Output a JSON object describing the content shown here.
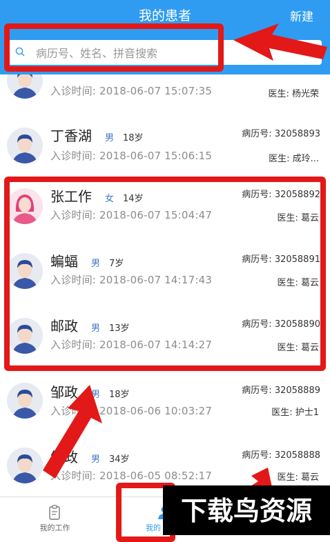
{
  "header": {
    "title": "我的患者",
    "new_label": "新建"
  },
  "search": {
    "placeholder": "病历号、姓名、拼音搜索"
  },
  "patients": [
    {
      "name": "",
      "gender": "",
      "age": "",
      "visit_label": "入诊时间:",
      "visit_time": "2018-06-07 15:07:35",
      "record_label": "",
      "record_no": "",
      "doctor_label": "医生:",
      "doctor": "杨光荣",
      "avatar": "male"
    },
    {
      "name": "丁香湖",
      "gender": "男",
      "age": "18岁",
      "visit_label": "入诊时间:",
      "visit_time": "2018-06-07 15:06:15",
      "record_label": "病历号:",
      "record_no": "32058893",
      "doctor_label": "医生:",
      "doctor": "成玲...",
      "avatar": "male"
    },
    {
      "name": "张工作",
      "gender": "女",
      "age": "14岁",
      "visit_label": "入诊时间:",
      "visit_time": "2018-06-07 15:04:47",
      "record_label": "病历号:",
      "record_no": "32058892",
      "doctor_label": "医生:",
      "doctor": "葛云",
      "avatar": "female"
    },
    {
      "name": "蝙蝠",
      "gender": "男",
      "age": "7岁",
      "visit_label": "入诊时间:",
      "visit_time": "2018-06-07 14:17:43",
      "record_label": "病历号:",
      "record_no": "32058891",
      "doctor_label": "医生:",
      "doctor": "葛云",
      "avatar": "male"
    },
    {
      "name": "邮政",
      "gender": "男",
      "age": "13岁",
      "visit_label": "入诊时间:",
      "visit_time": "2018-06-07 14:14:27",
      "record_label": "病历号:",
      "record_no": "32058890",
      "doctor_label": "医生:",
      "doctor": "葛云",
      "avatar": "male"
    },
    {
      "name": "邹政",
      "gender": "男",
      "age": "18岁",
      "visit_label": "入诊时间:",
      "visit_time": "2018-06-06 10:03:27",
      "record_label": "病历号:",
      "record_no": "32058889",
      "doctor_label": "医生:",
      "doctor": "护士1",
      "avatar": "male"
    },
    {
      "name": "邹政",
      "gender": "男",
      "age": "34岁",
      "visit_label": "入诊时间:",
      "visit_time": "2018-06-05 08:52:17",
      "record_label": "病历号:",
      "record_no": "32058888",
      "doctor_label": "医生:",
      "doctor": "葛云",
      "avatar": "male"
    }
  ],
  "bottom_nav": [
    {
      "label": "我的工作",
      "icon": "clipboard-icon",
      "active": false
    },
    {
      "label": "我的",
      "icon": "doctor-icon",
      "active": true
    }
  ],
  "watermark": {
    "text": "下载鸟资源"
  },
  "colors": {
    "primary": "#2f9cf1",
    "highlight": "#e31818",
    "gender": "#3f78c9"
  }
}
